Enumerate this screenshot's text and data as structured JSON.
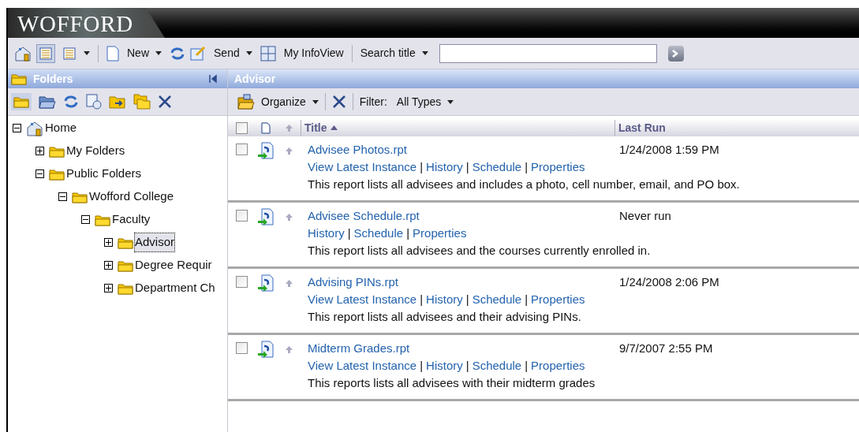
{
  "brand": "WOFFORD",
  "toolbar": {
    "views": [
      {
        "selected": true
      },
      {
        "selected": false
      }
    ],
    "new_label": "New",
    "send_label": "Send",
    "myinfoview_label": "My InfoView",
    "search_label": "Search title"
  },
  "folders_panel": {
    "title": "Folders"
  },
  "tree": [
    {
      "label": "Home",
      "kind": "home",
      "expanded": true,
      "selected": false,
      "children": [
        {
          "label": "My Folders",
          "kind": "folder",
          "expanded": false,
          "selected": false
        },
        {
          "label": "Public Folders",
          "kind": "folder",
          "expanded": true,
          "selected": false,
          "children": [
            {
              "label": "Wofford College",
              "kind": "folder",
              "expanded": true,
              "selected": false,
              "children": [
                {
                  "label": "Faculty",
                  "kind": "folder",
                  "expanded": true,
                  "selected": false,
                  "children": [
                    {
                      "label": "Advisor",
                      "kind": "folder",
                      "expanded": false,
                      "selected": true
                    },
                    {
                      "label": "Degree Requir",
                      "kind": "folder",
                      "expanded": false,
                      "selected": false
                    },
                    {
                      "label": "Department Ch",
                      "kind": "folder",
                      "expanded": false,
                      "selected": false
                    }
                  ]
                }
              ]
            }
          ]
        }
      ]
    }
  ],
  "content": {
    "title": "Advisor",
    "organize_label": "Organize",
    "filter_label": "Filter:",
    "filter_value": "All Types",
    "select_all_checked": false,
    "link_separator": "|",
    "columns": [
      {
        "label": "Title",
        "sorted": true
      },
      {
        "label": "Last Run",
        "sorted": false
      }
    ],
    "reports": [
      {
        "name": "Advisee Photos.rpt",
        "checked": false,
        "last_run": "1/24/2008 1:59 PM",
        "links": [
          "View Latest Instance",
          "History",
          "Schedule",
          "Properties"
        ],
        "description": "This report lists all advisees and includes a photo, cell number, email, and PO box."
      },
      {
        "name": "Advisee Schedule.rpt",
        "checked": false,
        "last_run": "Never run",
        "links": [
          "History",
          "Schedule",
          "Properties"
        ],
        "description": "This report lists all advisees and the courses currently enrolled in."
      },
      {
        "name": "Advising PINs.rpt",
        "checked": false,
        "last_run": "1/24/2008 2:06 PM",
        "links": [
          "View Latest Instance",
          "History",
          "Schedule",
          "Properties"
        ],
        "description": "This report lists all advisees and their advising PINs."
      },
      {
        "name": "Midterm Grades.rpt",
        "checked": false,
        "last_run": "9/7/2007 2:55 PM",
        "links": [
          "View Latest Instance",
          "History",
          "Schedule",
          "Properties"
        ],
        "description": "This reports lists all advisees with their midterm grades"
      }
    ]
  }
}
